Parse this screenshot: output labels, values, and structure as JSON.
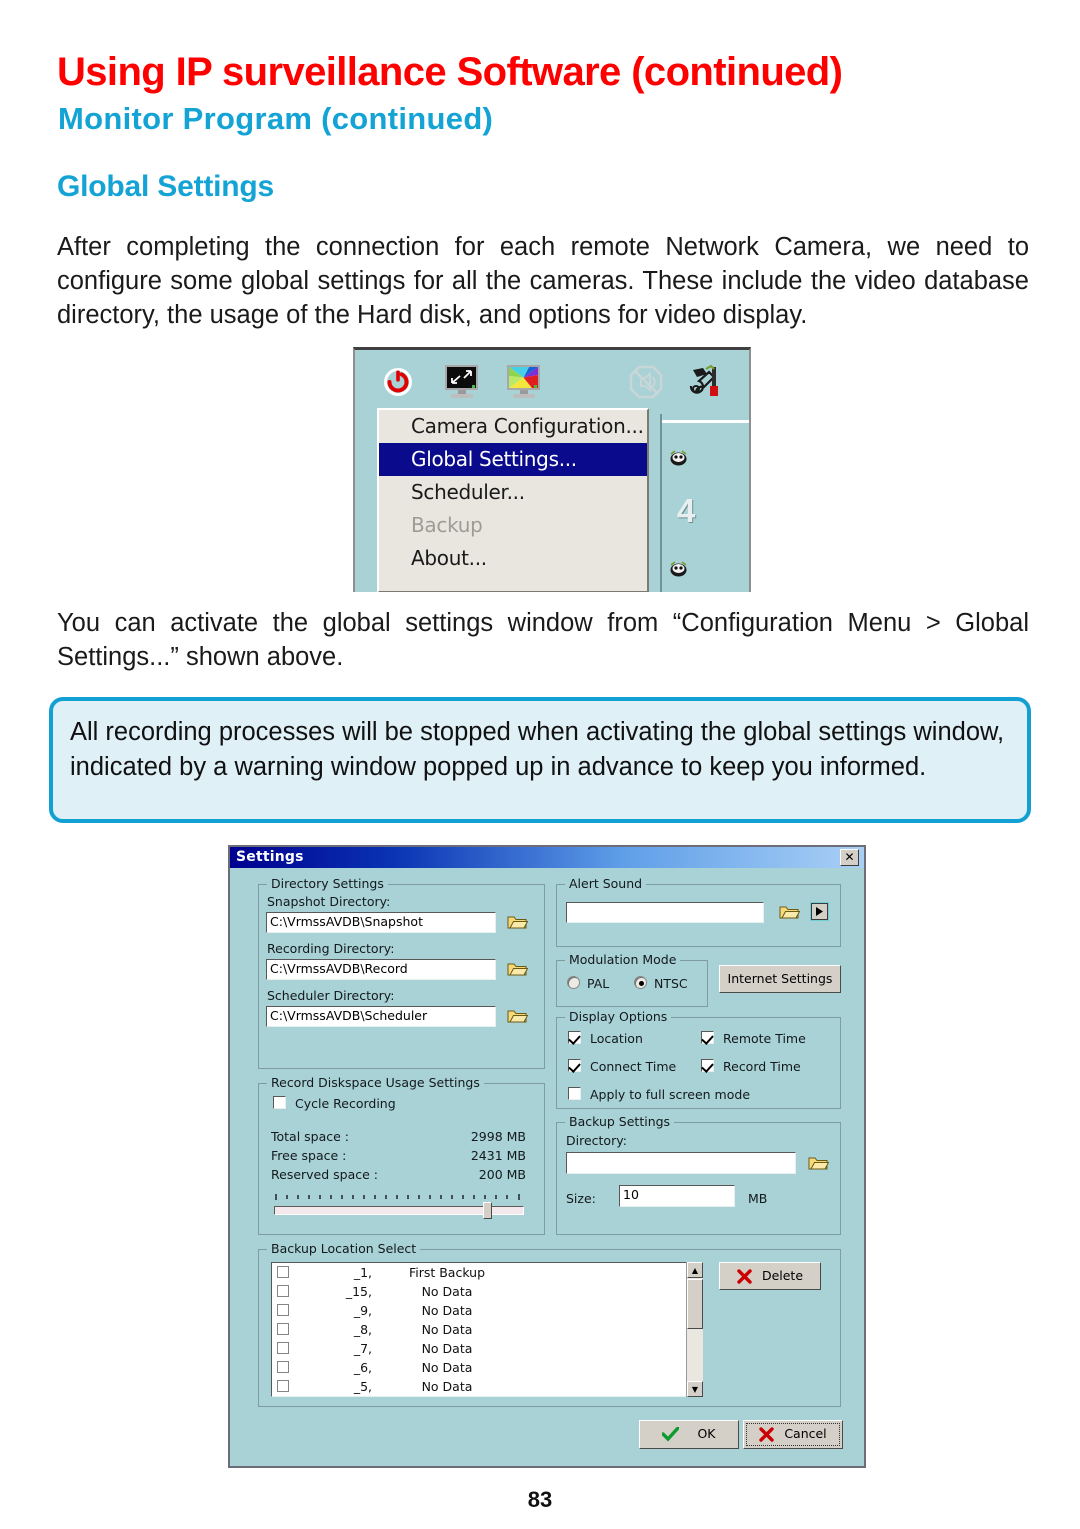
{
  "page": {
    "title": "Using IP surveillance Software (continued)",
    "subtitle": "Monitor Program (continued)",
    "section": "Global Settings",
    "number": "83",
    "title_color": "#ff0000",
    "accent_color": "#13a3d4"
  },
  "body": {
    "paragraph_1": "After completing the connection for each remote Network Camera, we need to configure some global settings for all the cameras. These include the video database directory, the usage of the Hard disk, and options for video display.",
    "paragraph_2": "You can activate the global settings window from “Configuration Menu > Global Settings...” shown above.",
    "callout": "All recording processes will be stopped when activating the global settings window, indicated by a warning window popped up in advance to keep you informed."
  },
  "menu_figure": {
    "toolbar_icons": [
      "power-icon",
      "monitor-minimize-icon",
      "monitor-color-icon",
      "no-audio-icon",
      "tools-icon"
    ],
    "items": [
      {
        "label": "Camera Configuration...",
        "state": "normal"
      },
      {
        "label": "Global Settings...",
        "state": "selected"
      },
      {
        "label": "Scheduler...",
        "state": "normal"
      },
      {
        "label": "Backup",
        "state": "disabled"
      },
      {
        "label": "About...",
        "state": "normal"
      }
    ],
    "background_digit": "4"
  },
  "dialog": {
    "title": "Settings",
    "close_label": "✕",
    "directory_settings": {
      "group_label": "Directory Settings",
      "fields": [
        {
          "label": "Snapshot Directory:",
          "value": "C:\\VrmssAVDB\\Snapshot"
        },
        {
          "label": "Recording Directory:",
          "value": "C:\\VrmssAVDB\\Record"
        },
        {
          "label": "Scheduler Directory:",
          "value": "C:\\VrmssAVDB\\Scheduler"
        }
      ]
    },
    "diskspace": {
      "group_label": "Record Diskspace Usage Settings",
      "cycle_recording_label": "Cycle Recording",
      "cycle_recording_checked": false,
      "rows": [
        {
          "label": "Total space :",
          "value": "2998 MB"
        },
        {
          "label": "Free space :",
          "value": "2431 MB"
        },
        {
          "label": "Reserved space :",
          "value": "200 MB"
        }
      ],
      "slider_percent": 92
    },
    "alert_sound": {
      "group_label": "Alert Sound",
      "value": "",
      "browse_icon": "folder-icon",
      "play_icon": "play-icon"
    },
    "modulation_mode": {
      "group_label": "Modulation Mode",
      "options": [
        {
          "label": "PAL",
          "selected": false
        },
        {
          "label": "NTSC",
          "selected": true
        }
      ]
    },
    "internet_settings_button": "Internet Settings",
    "display_options": {
      "group_label": "Display Options",
      "options": [
        {
          "label": "Location",
          "checked": true
        },
        {
          "label": "Remote Time",
          "checked": true
        },
        {
          "label": "Connect Time",
          "checked": true
        },
        {
          "label": "Record Time",
          "checked": true
        },
        {
          "label": "Apply to full screen mode",
          "checked": false
        }
      ]
    },
    "backup_settings": {
      "group_label": "Backup Settings",
      "directory_label": "Directory:",
      "directory_value": "",
      "size_label": "Size:",
      "size_value": "10",
      "size_unit": "MB"
    },
    "backup_location_select": {
      "group_label": "Backup Location Select",
      "rows": [
        {
          "id": "_1,",
          "name": "First Backup",
          "checked": false
        },
        {
          "id": "_15,",
          "name": "No Data",
          "checked": false
        },
        {
          "id": "_9,",
          "name": "No Data",
          "checked": false
        },
        {
          "id": "_8,",
          "name": "No Data",
          "checked": false
        },
        {
          "id": "_7,",
          "name": "No Data",
          "checked": false
        },
        {
          "id": "_6,",
          "name": "No Data",
          "checked": false
        },
        {
          "id": "_5,",
          "name": "No Data",
          "checked": false
        }
      ],
      "delete_button": "Delete"
    },
    "footer": {
      "ok_label": "OK",
      "cancel_label": "Cancel"
    }
  }
}
